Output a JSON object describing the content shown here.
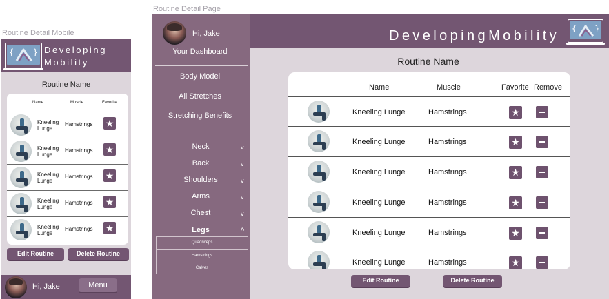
{
  "captions": {
    "mobile": "Routine Detail Mobile",
    "desktop": "Routine Detail Page"
  },
  "brand": {
    "line1": "Developing",
    "line2": "Mobility",
    "full": "DevelopingMobility"
  },
  "colors": {
    "header": "#735672",
    "sidebar": "#86697f",
    "background": "#ddd6dc",
    "button": "#6e526e",
    "card": "#ffffff"
  },
  "routine": {
    "title": "Routine Name",
    "columns": {
      "name": "Name",
      "muscle": "Muscle",
      "favorite": "Favorite",
      "remove": "Remove"
    },
    "mobile_rows": [
      {
        "name": "Kneeling Lunge",
        "muscle": "Hamstrings"
      },
      {
        "name": "Kneeling Lunge",
        "muscle": "Hamstrings"
      },
      {
        "name": "Kneeling Lunge",
        "muscle": "Hamstrings"
      },
      {
        "name": "Kneeling Lunge",
        "muscle": "Hamstrings"
      },
      {
        "name": "Kneeling Lunge",
        "muscle": "Hamstrings"
      }
    ],
    "desktop_rows": [
      {
        "name": "Kneeling Lunge",
        "muscle": "Hamstrings"
      },
      {
        "name": "Kneeling Lunge",
        "muscle": "Hamstrings"
      },
      {
        "name": "Kneeling Lunge",
        "muscle": "Hamstrings"
      },
      {
        "name": "Kneeling Lunge",
        "muscle": "Hamstrings"
      },
      {
        "name": "Kneeling Lunge",
        "muscle": "Hamstrings"
      },
      {
        "name": "Kneeling Lunge",
        "muscle": "Hamstrings"
      }
    ],
    "favorite_icon": "star-icon",
    "remove_icon": "minus-icon"
  },
  "actions": {
    "edit": "Edit Routine",
    "delete": "Delete Routine"
  },
  "user": {
    "greeting": "Hi, Jake",
    "dashboard": "Your Dashboard",
    "menu": "Menu"
  },
  "sidebar": {
    "nav": [
      "Body Model",
      "All Stretches",
      "Stretching Benefits"
    ],
    "categories": [
      {
        "label": "Neck",
        "chevron": "v"
      },
      {
        "label": "Back",
        "chevron": "v"
      },
      {
        "label": "Shoulders",
        "chevron": "v"
      },
      {
        "label": "Arms",
        "chevron": "v"
      },
      {
        "label": "Chest",
        "chevron": "v"
      },
      {
        "label": "Legs",
        "chevron": "^"
      }
    ],
    "legs_sub": [
      "Quadriceps",
      "Hamstrings",
      "Calves"
    ]
  }
}
